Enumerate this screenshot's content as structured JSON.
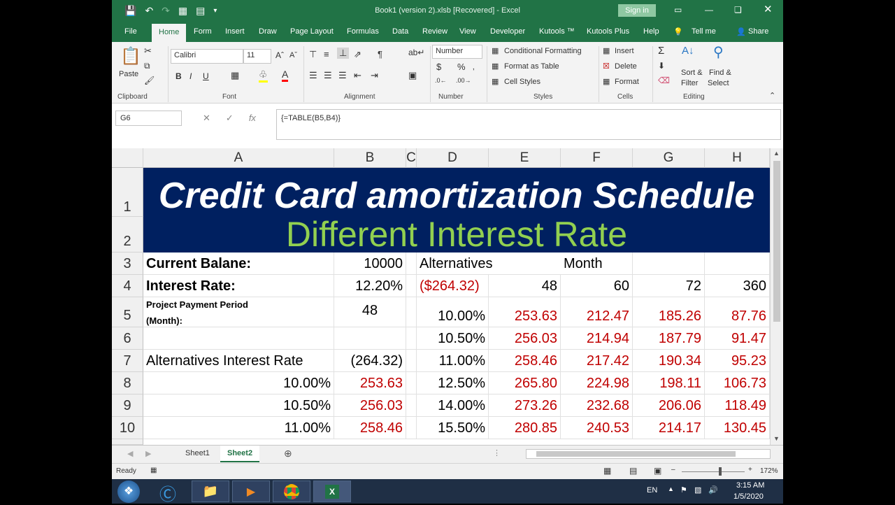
{
  "window": {
    "title": "Book1 (version 2).xlsb [Recovered]  -  Excel",
    "signin": "Sign in"
  },
  "tabs": [
    "File",
    "Home",
    "Form",
    "Insert",
    "Draw",
    "Page Layout",
    "Formulas",
    "Data",
    "Review",
    "View",
    "Developer",
    "Kutools ™",
    "Kutools Plus",
    "Help",
    "Tell me",
    "Share"
  ],
  "ribbon": {
    "paste": "Paste",
    "font_name": "Calibri",
    "font_size": "11",
    "number_format": "Number",
    "conditional_formatting": "Conditional Formatting",
    "format_as_table": "Format as Table",
    "cell_styles": "Cell Styles",
    "insert": "Insert",
    "delete": "Delete",
    "format": "Format",
    "sort_filter_1": "Sort &",
    "sort_filter_2": "Filter",
    "find_select_1": "Find &",
    "find_select_2": "Select",
    "groups": {
      "clipboard": "Clipboard",
      "font": "Font",
      "alignment": "Alignment",
      "number": "Number",
      "styles": "Styles",
      "cells": "Cells",
      "editing": "Editing"
    }
  },
  "formula_bar": {
    "name_box": "G6",
    "formula": "{=TABLE(B5,B4)}"
  },
  "columns": [
    "A",
    "B",
    "C",
    "D",
    "E",
    "F",
    "G",
    "H"
  ],
  "rows": [
    "1",
    "2",
    "3",
    "4",
    "5",
    "6",
    "7",
    "8",
    "9",
    "10"
  ],
  "banner": {
    "title": "Credit Card amortization Schedule",
    "subtitle": "Different Interest Rate"
  },
  "cells": {
    "A3": "Current Balane:",
    "B3": "10000",
    "D3": "Alternatives",
    "F3": "Month",
    "A4": "Interest Rate:",
    "B4": "12.20%",
    "D4": "($264.32)",
    "E4": "48",
    "F4": "60",
    "G4": "72",
    "H4": "360",
    "A5a": "Project Payment Period",
    "A5b": "(Month):",
    "B5": "48",
    "D5": "10.00%",
    "E5": "253.63",
    "F5": "212.47",
    "G5": "185.26",
    "H5": "87.76",
    "D6": "10.50%",
    "E6": "256.03",
    "F6": "214.94",
    "G6": "187.79",
    "H6": "91.47",
    "A7": "Alternatives Interest Rate",
    "B7": "(264.32)",
    "D7": "11.00%",
    "E7": "258.46",
    "F7": "217.42",
    "G7": "190.34",
    "H7": "95.23",
    "A8": "10.00%",
    "B8": "253.63",
    "D8": "12.50%",
    "E8": "265.80",
    "F8": "224.98",
    "G8": "198.11",
    "H8": "106.73",
    "A9": "10.50%",
    "B9": "256.03",
    "D9": "14.00%",
    "E9": "273.26",
    "F9": "232.68",
    "G9": "206.06",
    "H9": "118.49",
    "A10": "11.00%",
    "B10": "258.46",
    "D10": "15.50%",
    "E10": "280.85",
    "F10": "240.53",
    "G10": "214.17",
    "H10": "130.45"
  },
  "sheets": [
    "Sheet1",
    "Sheet2"
  ],
  "status": {
    "ready": "Ready",
    "zoom": "172%"
  },
  "tray": {
    "lang": "EN",
    "time": "3:15 AM",
    "date": "1/5/2020"
  }
}
